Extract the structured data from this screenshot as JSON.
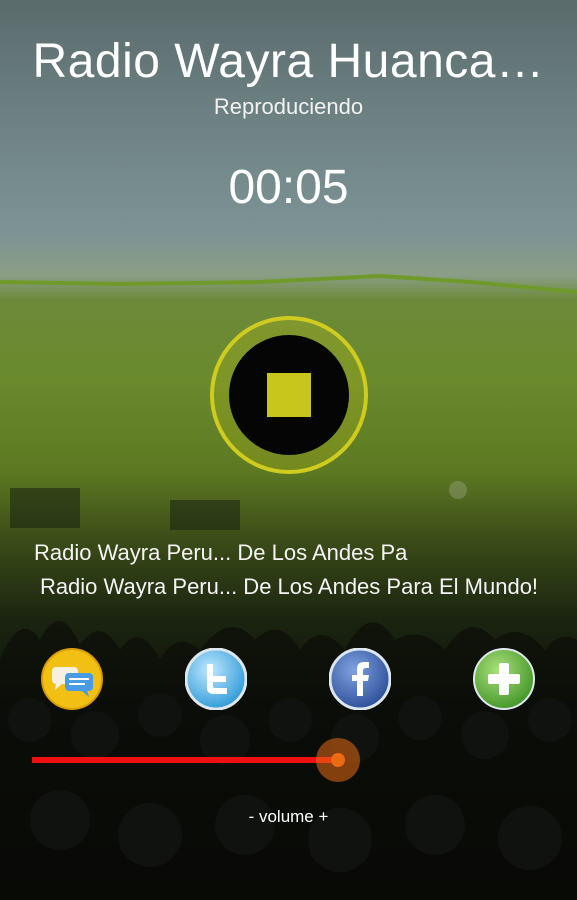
{
  "player": {
    "station_title": "Radio Wayra Huanca…",
    "status": "Reproduciendo",
    "elapsed": "00:05"
  },
  "now_playing": {
    "marquee": "Radio Wayra Peru... De Los Andes Pa",
    "description": "Radio Wayra Peru... De Los Andes Para El Mundo!"
  },
  "share": {
    "buttons": [
      "chat-icon",
      "twitter-icon",
      "facebook-icon",
      "add-icon"
    ]
  },
  "volume": {
    "label": "- volume +",
    "level": 0.9
  },
  "colors": {
    "accent": "#cfcc1f",
    "volume_track": "#ee1111",
    "volume_thumb": "#ee6a10"
  }
}
